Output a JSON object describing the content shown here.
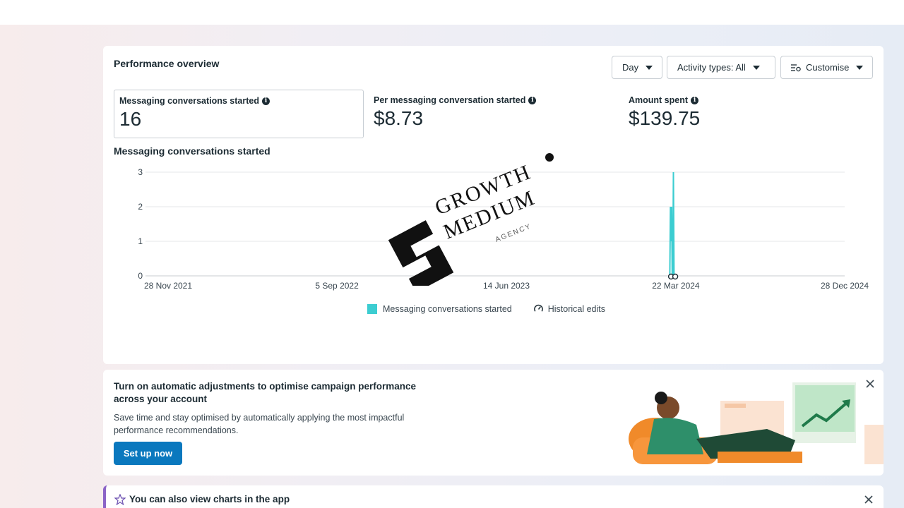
{
  "performance": {
    "title": "Performance overview",
    "controls": {
      "day": "Day",
      "activity": "Activity types: All",
      "customise": "Customise"
    },
    "metrics": [
      {
        "label": "Messaging conversations started",
        "value": "16"
      },
      {
        "label": "Per messaging conversation started",
        "value": "$8.73"
      },
      {
        "label": "Amount spent",
        "value": "$139.75"
      }
    ],
    "chart_title": "Messaging conversations started",
    "legend": {
      "series": "Messaging conversations started",
      "edits": "Historical edits"
    },
    "colors": {
      "series": "#3ccdd1",
      "accent": "#0a78be"
    }
  },
  "chart_data": {
    "type": "line",
    "x_ticks": [
      "28 Nov 2021",
      "5 Sep 2022",
      "14 Jun 2023",
      "22 Mar 2024",
      "28 Dec 2024"
    ],
    "y_ticks": [
      0,
      1,
      2,
      3
    ],
    "ylim": [
      0,
      3
    ],
    "xlim": [
      "2021-11-28",
      "2024-12-28"
    ],
    "series": [
      {
        "name": "Messaging conversations started",
        "points": [
          [
            "2024-03-12",
            0
          ],
          [
            "2024-03-13",
            2
          ],
          [
            "2024-03-14",
            1
          ],
          [
            "2024-03-15",
            2
          ],
          [
            "2024-03-16",
            0
          ],
          [
            "2024-03-17",
            0
          ],
          [
            "2024-03-18",
            3
          ],
          [
            "2024-03-19",
            0
          ]
        ]
      }
    ],
    "grid": true,
    "legend": "bottom-center"
  },
  "watermark": {
    "line1": "GROWTH",
    "line2": "MEDIUM",
    "line3": "AGENCY"
  },
  "promo": {
    "title": "Turn on automatic adjustments to optimise campaign performance across your account",
    "text": "Save time and stay optimised by automatically applying the most impactful performance recommendations.",
    "button": "Set up now"
  },
  "app_card": {
    "title": "You can also view charts in the app"
  }
}
